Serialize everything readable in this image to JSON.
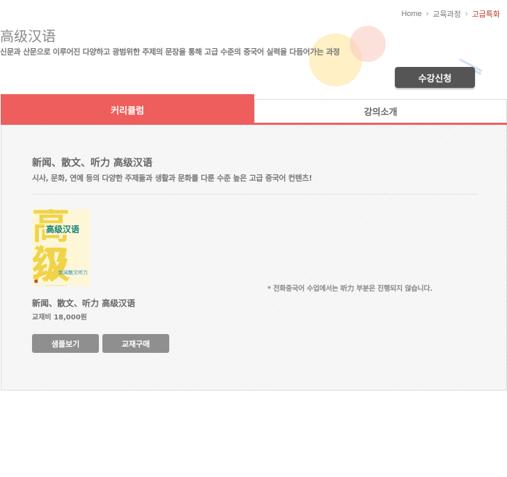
{
  "breadcrumb": {
    "home": "Home",
    "level1": "교육과정",
    "current": "고급특화"
  },
  "header": {
    "title": "高级汉语",
    "description": "신문과 산문으로 이루어진 다양하고 광범위한 주제의 문장을 통해 고급 수준의 중국어 실력을 다듬어가는 과정",
    "enroll_label": "수강신청"
  },
  "tabs": [
    {
      "label": "커리큘럼",
      "active": true
    },
    {
      "label": "강의소개",
      "active": false
    }
  ],
  "course": {
    "title": "新闻、散文、听力 高级汉语",
    "subtitle": "시사, 문화, 연예 등의 다양한 주제들과 생활과 문화를 다룬 수준 높은 고급 중국어 컨텐츠!",
    "book": {
      "cover_text_1": "高级",
      "cover_text_2": "汉语",
      "cover_band": "高级汉语",
      "cover_small": "新闻散文听力",
      "name": "新闻、散文、听力 高级汉语",
      "price": "교재비 18,000원"
    },
    "note": "* 전화중국어 수업에서는  听力 부분은 진행되지 않습니다.",
    "buttons": {
      "sample": "샘플보기",
      "buy": "교재구매"
    }
  },
  "colors": {
    "accent": "#ee5e5c",
    "button_dark": "#555555",
    "button_gray": "#8f8f8f"
  }
}
